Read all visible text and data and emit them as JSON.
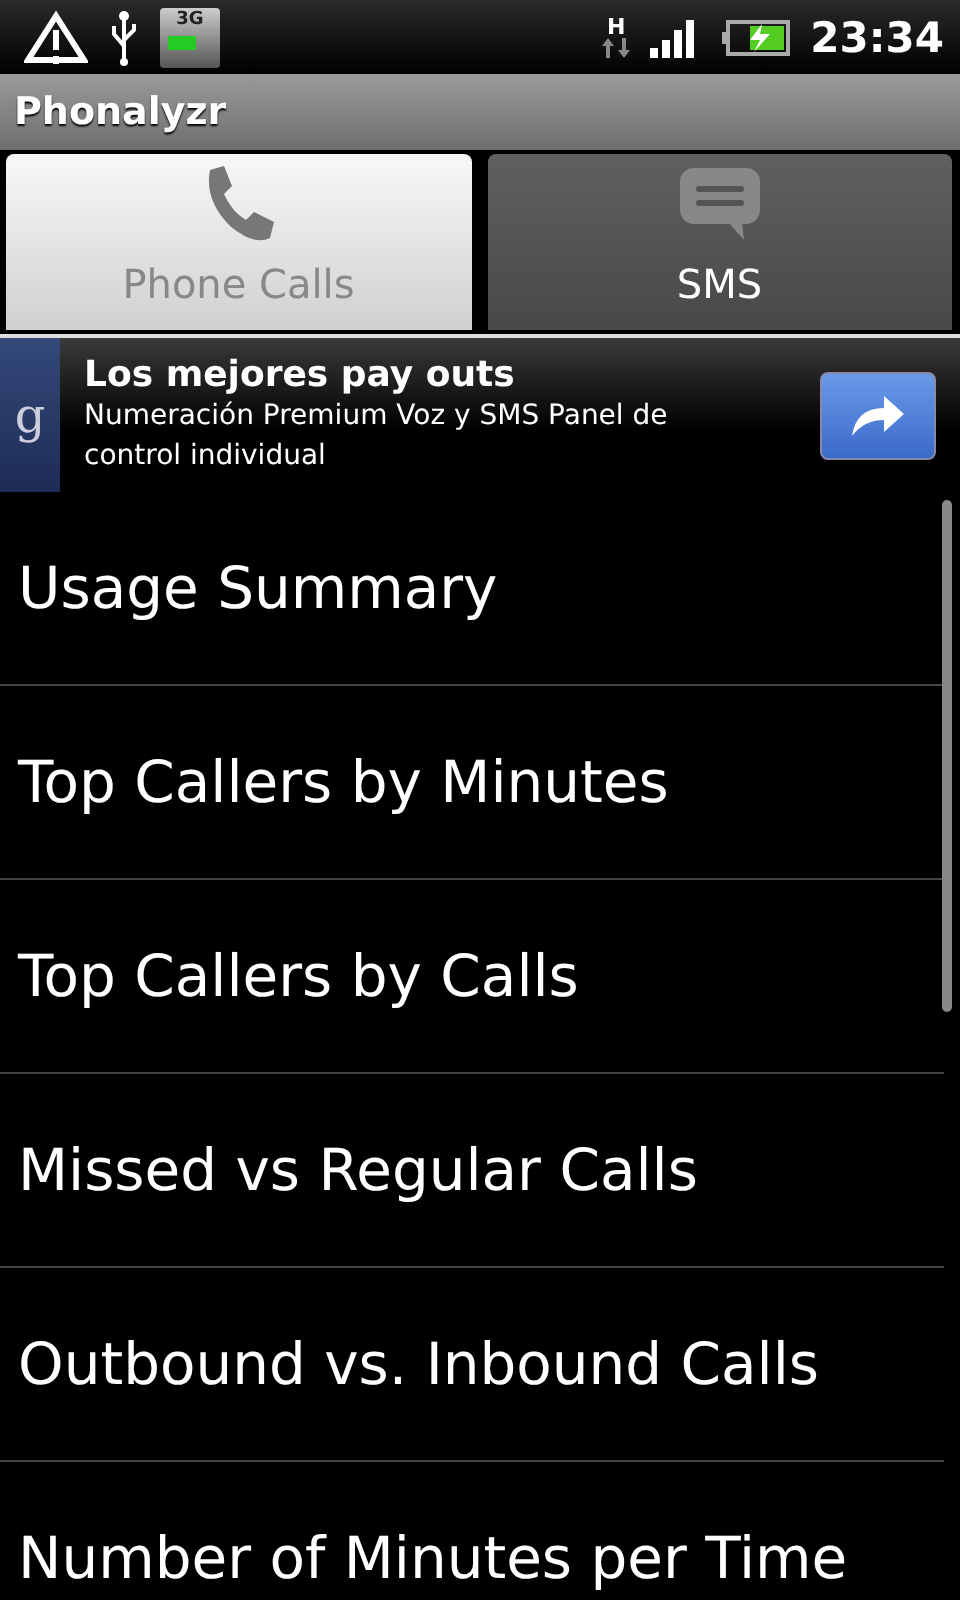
{
  "status_bar": {
    "network_badge": "3G",
    "data_badge": "H",
    "time": "23:34"
  },
  "title_bar": {
    "title": "Phonalyzr"
  },
  "tabs": [
    {
      "label": "Phone Calls",
      "kind": "phone",
      "selected": true
    },
    {
      "label": "SMS",
      "kind": "sms",
      "selected": false
    }
  ],
  "ad": {
    "logo": "g",
    "headline": "Los mejores pay outs",
    "text": "Numeración Premium Voz y SMS Panel de control individual"
  },
  "menu_items": [
    {
      "label": "Usage Summary"
    },
    {
      "label": "Top Callers by Minutes"
    },
    {
      "label": "Top Callers by Calls"
    },
    {
      "label": "Missed vs Regular Calls"
    },
    {
      "label": "Outbound vs. Inbound Calls"
    },
    {
      "label": "Number of Minutes per Time"
    }
  ]
}
